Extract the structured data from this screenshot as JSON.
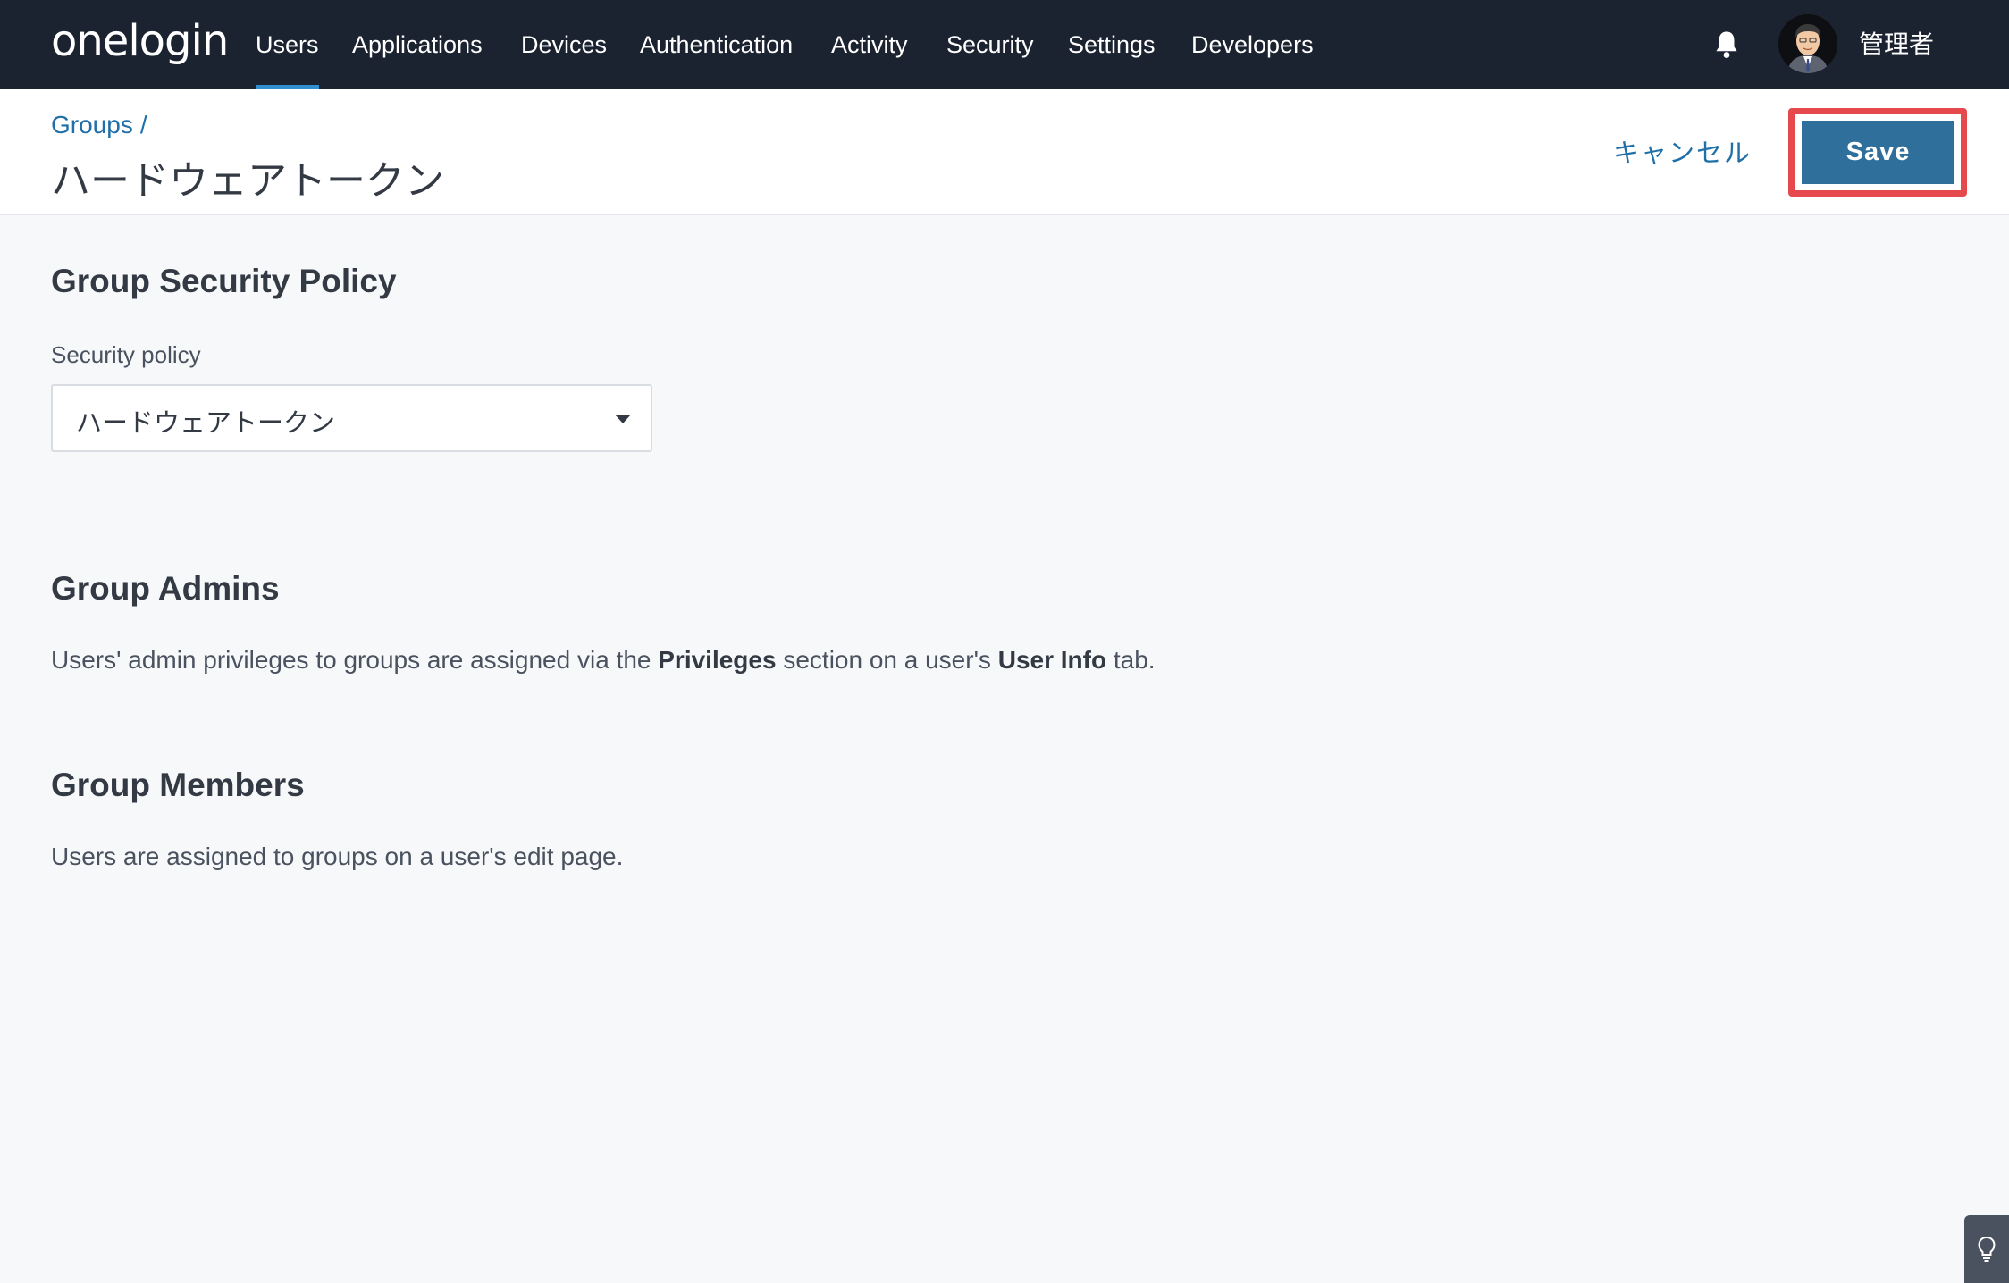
{
  "nav": {
    "logo": "onelogin",
    "items": [
      {
        "label": "Users",
        "active": true
      },
      {
        "label": "Applications"
      },
      {
        "label": "Devices"
      },
      {
        "label": "Authentication"
      },
      {
        "label": "Activity"
      },
      {
        "label": "Security"
      },
      {
        "label": "Settings"
      },
      {
        "label": "Developers"
      }
    ],
    "bell_icon": "bell-icon",
    "user_name": "管理者"
  },
  "header": {
    "breadcrumb": "Groups",
    "breadcrumb_sep": "/",
    "title": "ハードウェアトークン",
    "cancel_label": "キャンセル",
    "save_label": "Save"
  },
  "security": {
    "title": "Group Security Policy",
    "field_label": "Security policy",
    "selected": "ハードウェアトークン"
  },
  "admins": {
    "title": "Group Admins",
    "text_before": "Users' admin privileges to groups are assigned via the ",
    "bold1": "Privileges",
    "text_mid": " section on a user's ",
    "bold2": "User Info",
    "text_after": " tab."
  },
  "members": {
    "title": "Group Members",
    "text": "Users are assigned to groups on a user's edit page."
  },
  "colors": {
    "nav_bg": "#1c2330",
    "accent": "#2f6f9c",
    "link": "#1f6fa8",
    "highlight": "#e5484d"
  }
}
